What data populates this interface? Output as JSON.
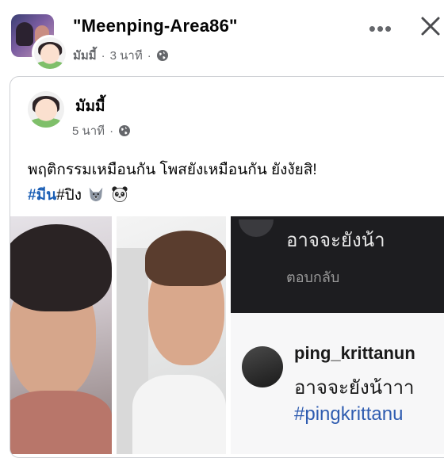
{
  "header": {
    "group_name": "\"Meenping-Area86\"",
    "author": "มัมมี้",
    "time": "3 นาที",
    "separator": "·",
    "more_label": "•••",
    "close_label": "✕"
  },
  "original_post": {
    "author": "มัมมี้",
    "time": "5 นาที",
    "separator": "·",
    "text": "พฤติกรรมเหมือนกัน โพสยังเหมือนกัน ยังงัยสิ!",
    "hashtag1": "#มีน",
    "hashtag2": "#ปิง"
  },
  "photos": {
    "screenshot": {
      "line1": "อาจจะยังน้า",
      "line2": "ตอบกลับ",
      "username": "ping_krittanun",
      "reply": "อาจจะยังน้าาา",
      "tag": "#pingkrittanu"
    }
  },
  "icons": {
    "globe": "globe-icon",
    "wolf": "wolf-emoji",
    "panda": "panda-emoji"
  },
  "colors": {
    "hashtag": "#1b5fb5",
    "meta": "#65676b",
    "text": "#050505"
  }
}
